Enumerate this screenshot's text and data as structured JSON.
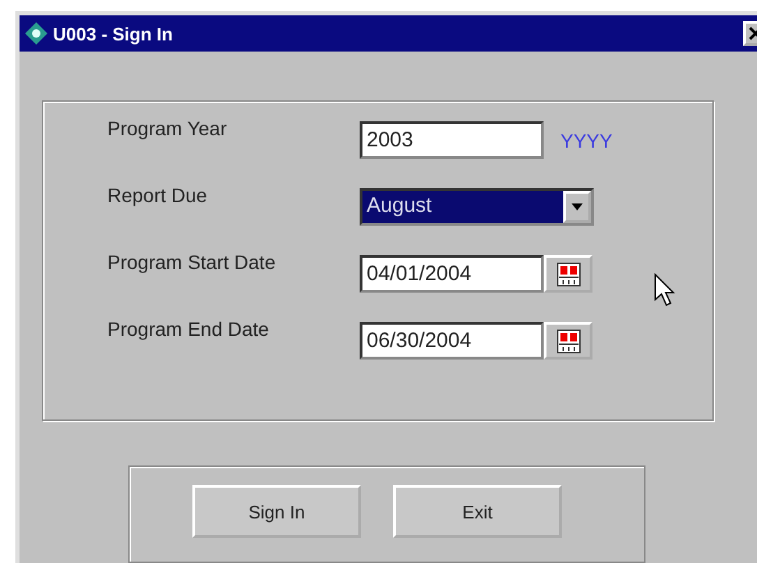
{
  "window": {
    "title": "U003 - Sign In"
  },
  "fields": [
    {
      "kind": "text",
      "label": "Program Year",
      "value": "2003",
      "hint": "YYYY"
    },
    {
      "kind": "dropdown",
      "label": "Report Due",
      "value": "August",
      "focused": true
    },
    {
      "kind": "date",
      "label": "Program Start Date",
      "value": "04/01/2004"
    },
    {
      "kind": "date",
      "label": "Program End Date",
      "value": "06/30/2004"
    }
  ],
  "buttons": [
    "Sign In",
    "Exit"
  ]
}
